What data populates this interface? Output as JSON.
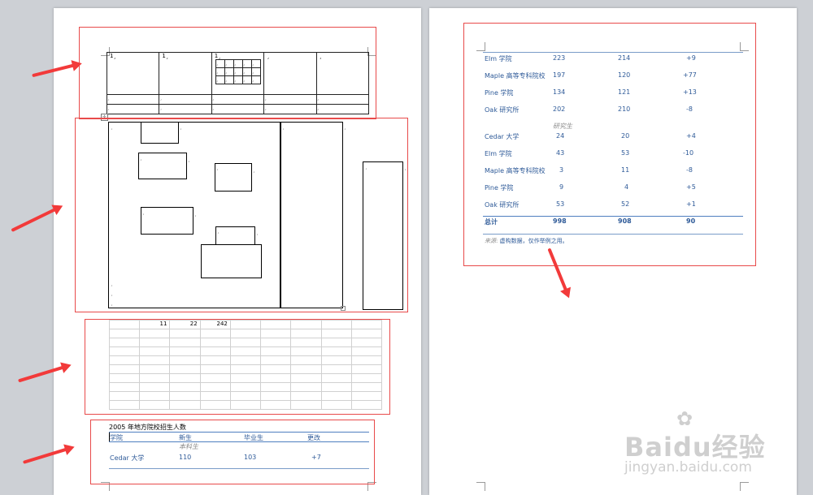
{
  "page1": {
    "top_table": {
      "cells_row1": [
        "1",
        "1",
        "1",
        "",
        ""
      ],
      "mark": "¸"
    },
    "sheet": {
      "values": [
        "11",
        "22",
        "242"
      ]
    },
    "report": {
      "title": "2005 年地方院校招生人数",
      "headers": [
        "学院",
        "新生",
        "毕业生",
        "更改"
      ],
      "subheader": "本科生",
      "row": {
        "name": "Cedar 大学",
        "new": "110",
        "grad": "103",
        "change": "+7"
      }
    }
  },
  "page2": {
    "rows_top": [
      {
        "name": "Elm 学院",
        "new": "223",
        "grad": "214",
        "change": "+9"
      },
      {
        "name": "Maple 高等专科院校",
        "new": "197",
        "grad": "120",
        "change": "+77"
      },
      {
        "name": "Pine 学院",
        "new": "134",
        "grad": "121",
        "change": "+13"
      },
      {
        "name": "Oak 研究所",
        "new": "202",
        "grad": "210",
        "change": "-8"
      }
    ],
    "subheader": "研究生",
    "rows_grad": [
      {
        "name": "Cedar 大学",
        "new": "24",
        "grad": "20",
        "change": "+4"
      },
      {
        "name": "Elm 学院",
        "new": "43",
        "grad": "53",
        "change": "-10"
      },
      {
        "name": "Maple 高等专科院校",
        "new": "3",
        "grad": "11",
        "change": "-8"
      },
      {
        "name": "Pine 学院",
        "new": "9",
        "grad": "4",
        "change": "+5"
      },
      {
        "name": "Oak 研究所",
        "new": "53",
        "grad": "52",
        "change": "+1"
      }
    ],
    "total": {
      "label": "总计",
      "new": "998",
      "grad": "908",
      "change": "90"
    },
    "source": {
      "label": "来源",
      "text": "虚构数据，仅作举例之用。"
    }
  },
  "watermark": {
    "logo": "Baidu经验",
    "url": "jingyan.baidu.com"
  },
  "colors": {
    "annotation": "#e84a4a",
    "arrow": "#f23a3a",
    "table_text": "#2e5a98"
  }
}
